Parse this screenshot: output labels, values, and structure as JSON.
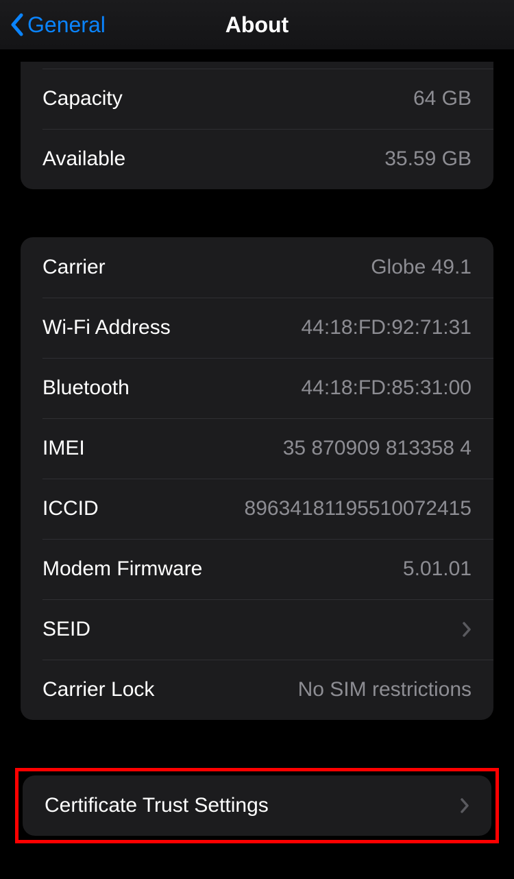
{
  "nav": {
    "back_label": "General",
    "title": "About"
  },
  "group1": {
    "rows": [
      {
        "label": "Capacity",
        "value": "64 GB"
      },
      {
        "label": "Available",
        "value": "35.59 GB"
      }
    ]
  },
  "group2": {
    "rows": [
      {
        "label": "Carrier",
        "value": "Globe 49.1"
      },
      {
        "label": "Wi-Fi Address",
        "value": "44:18:FD:92:71:31"
      },
      {
        "label": "Bluetooth",
        "value": "44:18:FD:85:31:00"
      },
      {
        "label": "IMEI",
        "value": "35 870909 813358 4"
      },
      {
        "label": "ICCID",
        "value": "89634181195510072415"
      },
      {
        "label": "Modem Firmware",
        "value": "5.01.01"
      },
      {
        "label": "SEID",
        "value": ""
      },
      {
        "label": "Carrier Lock",
        "value": "No SIM restrictions"
      }
    ]
  },
  "group3": {
    "row": {
      "label": "Certificate Trust Settings"
    }
  }
}
